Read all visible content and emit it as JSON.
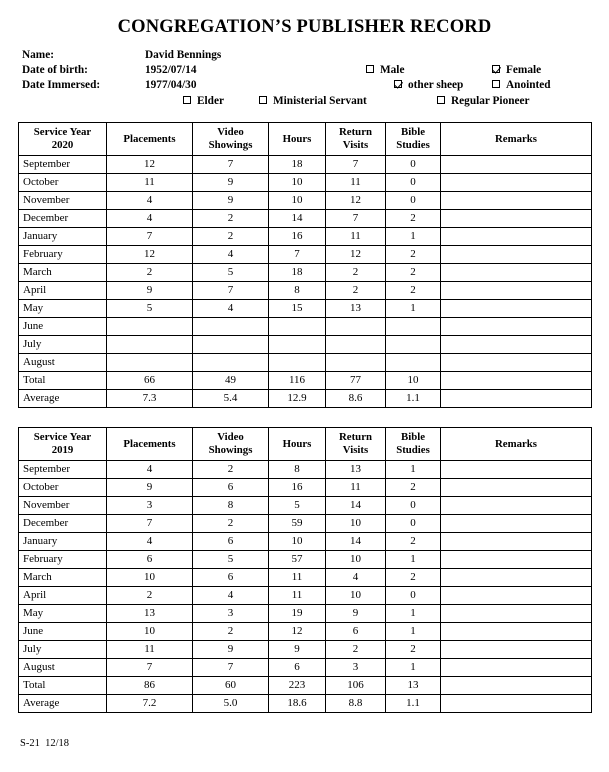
{
  "document": {
    "title": "CONGREGATION’S PUBLISHER RECORD",
    "form_code": "S-21  12/18"
  },
  "identity": {
    "name_label": "Name:",
    "name_value": "David Bennings",
    "dob_label": "Date of birth:",
    "dob_value": "1952/07/14",
    "immersed_label": "Date Immersed:",
    "immersed_value": "1977/04/30"
  },
  "checkboxes": {
    "male": {
      "label": "Male",
      "checked": false
    },
    "female": {
      "label": "Female",
      "checked": true
    },
    "other_sheep": {
      "label": "other sheep",
      "checked": true
    },
    "anointed": {
      "label": "Anointed",
      "checked": false
    },
    "elder": {
      "label": "Elder",
      "checked": false
    },
    "ministerial_servant": {
      "label": "Ministerial Servant",
      "checked": false
    },
    "regular_pioneer": {
      "label": "Regular Pioneer",
      "checked": false
    }
  },
  "columns": {
    "month_2020": "Service Year 2020",
    "month_2020_line1": "Service Year",
    "month_2020_line2": "2020",
    "month_2019_line1": "Service Year",
    "month_2019_line2": "2019",
    "placements": "Placements",
    "video_line1": "Video",
    "video_line2": "Showings",
    "hours": "Hours",
    "return_line1": "Return",
    "return_line2": "Visits",
    "bible_line1": "Bible",
    "bible_line2": "Studies",
    "remarks": "Remarks"
  },
  "table_2020": {
    "service_year": "2020",
    "rows": [
      {
        "month": "September",
        "placements": "12",
        "video": "7",
        "hours": "18",
        "returns": "7",
        "bible": "0",
        "remarks": ""
      },
      {
        "month": "October",
        "placements": "11",
        "video": "9",
        "hours": "10",
        "returns": "11",
        "bible": "0",
        "remarks": ""
      },
      {
        "month": "November",
        "placements": "4",
        "video": "9",
        "hours": "10",
        "returns": "12",
        "bible": "0",
        "remarks": ""
      },
      {
        "month": "December",
        "placements": "4",
        "video": "2",
        "hours": "14",
        "returns": "7",
        "bible": "2",
        "remarks": ""
      },
      {
        "month": "January",
        "placements": "7",
        "video": "2",
        "hours": "16",
        "returns": "11",
        "bible": "1",
        "remarks": ""
      },
      {
        "month": "February",
        "placements": "12",
        "video": "4",
        "hours": "7",
        "returns": "12",
        "bible": "2",
        "remarks": ""
      },
      {
        "month": "March",
        "placements": "2",
        "video": "5",
        "hours": "18",
        "returns": "2",
        "bible": "2",
        "remarks": ""
      },
      {
        "month": "April",
        "placements": "9",
        "video": "7",
        "hours": "8",
        "returns": "2",
        "bible": "2",
        "remarks": ""
      },
      {
        "month": "May",
        "placements": "5",
        "video": "4",
        "hours": "15",
        "returns": "13",
        "bible": "1",
        "remarks": ""
      },
      {
        "month": "June",
        "placements": "",
        "video": "",
        "hours": "",
        "returns": "",
        "bible": "",
        "remarks": ""
      },
      {
        "month": "July",
        "placements": "",
        "video": "",
        "hours": "",
        "returns": "",
        "bible": "",
        "remarks": ""
      },
      {
        "month": "August",
        "placements": "",
        "video": "",
        "hours": "",
        "returns": "",
        "bible": "",
        "remarks": ""
      },
      {
        "month": "Total",
        "placements": "66",
        "video": "49",
        "hours": "116",
        "returns": "77",
        "bible": "10",
        "remarks": ""
      },
      {
        "month": "Average",
        "placements": "7.3",
        "video": "5.4",
        "hours": "12.9",
        "returns": "8.6",
        "bible": "1.1",
        "remarks": ""
      }
    ]
  },
  "table_2019": {
    "service_year": "2019",
    "rows": [
      {
        "month": "September",
        "placements": "4",
        "video": "2",
        "hours": "8",
        "returns": "13",
        "bible": "1",
        "remarks": ""
      },
      {
        "month": "October",
        "placements": "9",
        "video": "6",
        "hours": "16",
        "returns": "11",
        "bible": "2",
        "remarks": ""
      },
      {
        "month": "November",
        "placements": "3",
        "video": "8",
        "hours": "5",
        "returns": "14",
        "bible": "0",
        "remarks": ""
      },
      {
        "month": "December",
        "placements": "7",
        "video": "2",
        "hours": "59",
        "returns": "10",
        "bible": "0",
        "remarks": ""
      },
      {
        "month": "January",
        "placements": "4",
        "video": "6",
        "hours": "10",
        "returns": "14",
        "bible": "2",
        "remarks": ""
      },
      {
        "month": "February",
        "placements": "6",
        "video": "5",
        "hours": "57",
        "returns": "10",
        "bible": "1",
        "remarks": ""
      },
      {
        "month": "March",
        "placements": "10",
        "video": "6",
        "hours": "11",
        "returns": "4",
        "bible": "2",
        "remarks": ""
      },
      {
        "month": "April",
        "placements": "2",
        "video": "4",
        "hours": "11",
        "returns": "10",
        "bible": "0",
        "remarks": ""
      },
      {
        "month": "May",
        "placements": "13",
        "video": "3",
        "hours": "19",
        "returns": "9",
        "bible": "1",
        "remarks": ""
      },
      {
        "month": "June",
        "placements": "10",
        "video": "2",
        "hours": "12",
        "returns": "6",
        "bible": "1",
        "remarks": ""
      },
      {
        "month": "July",
        "placements": "11",
        "video": "9",
        "hours": "9",
        "returns": "2",
        "bible": "2",
        "remarks": ""
      },
      {
        "month": "August",
        "placements": "7",
        "video": "7",
        "hours": "6",
        "returns": "3",
        "bible": "1",
        "remarks": ""
      },
      {
        "month": "Total",
        "placements": "86",
        "video": "60",
        "hours": "223",
        "returns": "106",
        "bible": "13",
        "remarks": ""
      },
      {
        "month": "Average",
        "placements": "7.2",
        "video": "5.0",
        "hours": "18.6",
        "returns": "8.8",
        "bible": "1.1",
        "remarks": ""
      }
    ]
  }
}
